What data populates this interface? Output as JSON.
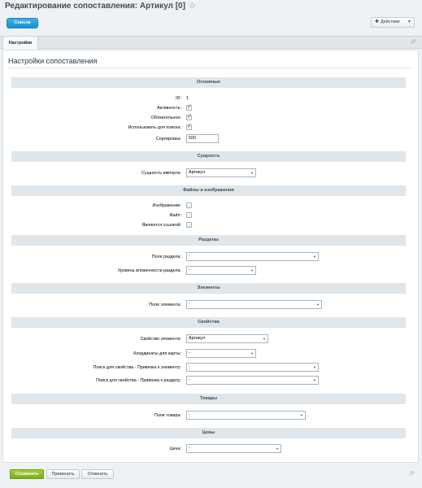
{
  "header": {
    "title": "Редактирование сопоставления: Артикул [0]",
    "list_label": "Список",
    "actions_label": "Действия"
  },
  "tabs": [
    {
      "label": "Настройки"
    }
  ],
  "main": {
    "title": "Настройки сопоставления",
    "sections": {
      "basic": "Основные",
      "entity": "Сущность",
      "files": "Файлы и изображения",
      "sections": "Разделы",
      "elements": "Элементы",
      "properties": "Свойства",
      "products": "Товары",
      "prices": "Цены"
    },
    "fields": {
      "id_label": "ID:",
      "id_value": "1",
      "active_label": "Активность:",
      "required_label": "Обязательное:",
      "search_label": "Использовать для поиска:",
      "sort_label": "Сортировка:",
      "sort_value": "500",
      "import_entity_label": "Сущность импорта:",
      "import_entity_value": "Артикул",
      "image_label": "Изображение:",
      "file_label": "Файл:",
      "link_label": "Являются ссылкой:",
      "section_field_label": "Поле раздела:",
      "section_field_value": "-",
      "section_depth_label": "Уровень вложенности раздела:",
      "section_depth_value": "-",
      "element_field_label": "Поле элемента:",
      "element_field_value": "-",
      "element_property_label": "Свойство элемента:",
      "element_property_value": "Артикул",
      "map_coords_label": "Координаты для карты:",
      "map_coords_value": "-",
      "search_elem_link_label": "Поиск для свойства - Привязка к элементу:",
      "search_elem_link_value": "-",
      "search_section_link_label": "Поиск для свойства - Привязка к разделу:",
      "search_section_link_value": "-",
      "product_field_label": "Поле товара:",
      "product_field_value": "-",
      "price_label": "Цена:",
      "price_value": "-"
    }
  },
  "footer": {
    "save_label": "Сохранить",
    "apply_label": "Применить",
    "cancel_label": "Отменить"
  }
}
